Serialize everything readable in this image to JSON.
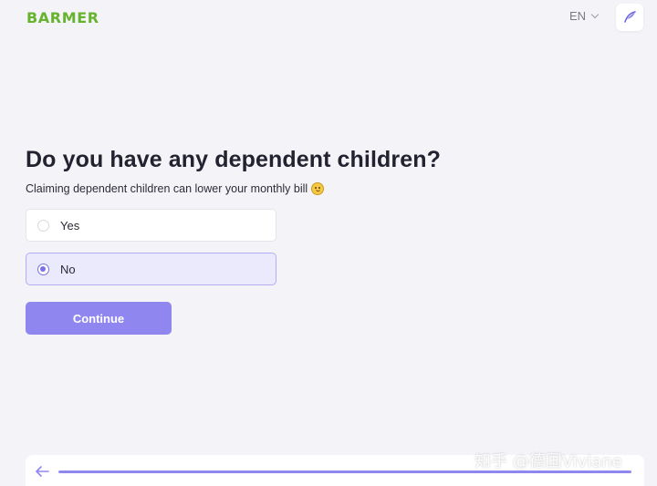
{
  "header": {
    "logo_text": "BARMER",
    "language": "EN",
    "language_icon": "chevron-down-icon",
    "edit_icon": "feather-pen-icon"
  },
  "main": {
    "title": "Do you have any dependent children?",
    "subtitle": "Claiming dependent children can lower your monthly bill",
    "subtitle_emoji": "smiling-face-icon",
    "options": [
      {
        "label": "Yes",
        "selected": false
      },
      {
        "label": "No",
        "selected": true
      }
    ],
    "continue_label": "Continue"
  },
  "footer": {
    "back_icon": "arrow-left-icon",
    "progress": 1.0
  },
  "watermark": "知乎 @德国Viviane",
  "colors": {
    "brand_green": "#66b32e",
    "accent": "#8f87ef",
    "selected_bg": "#ebeafd",
    "background": "#f4f4f8"
  }
}
